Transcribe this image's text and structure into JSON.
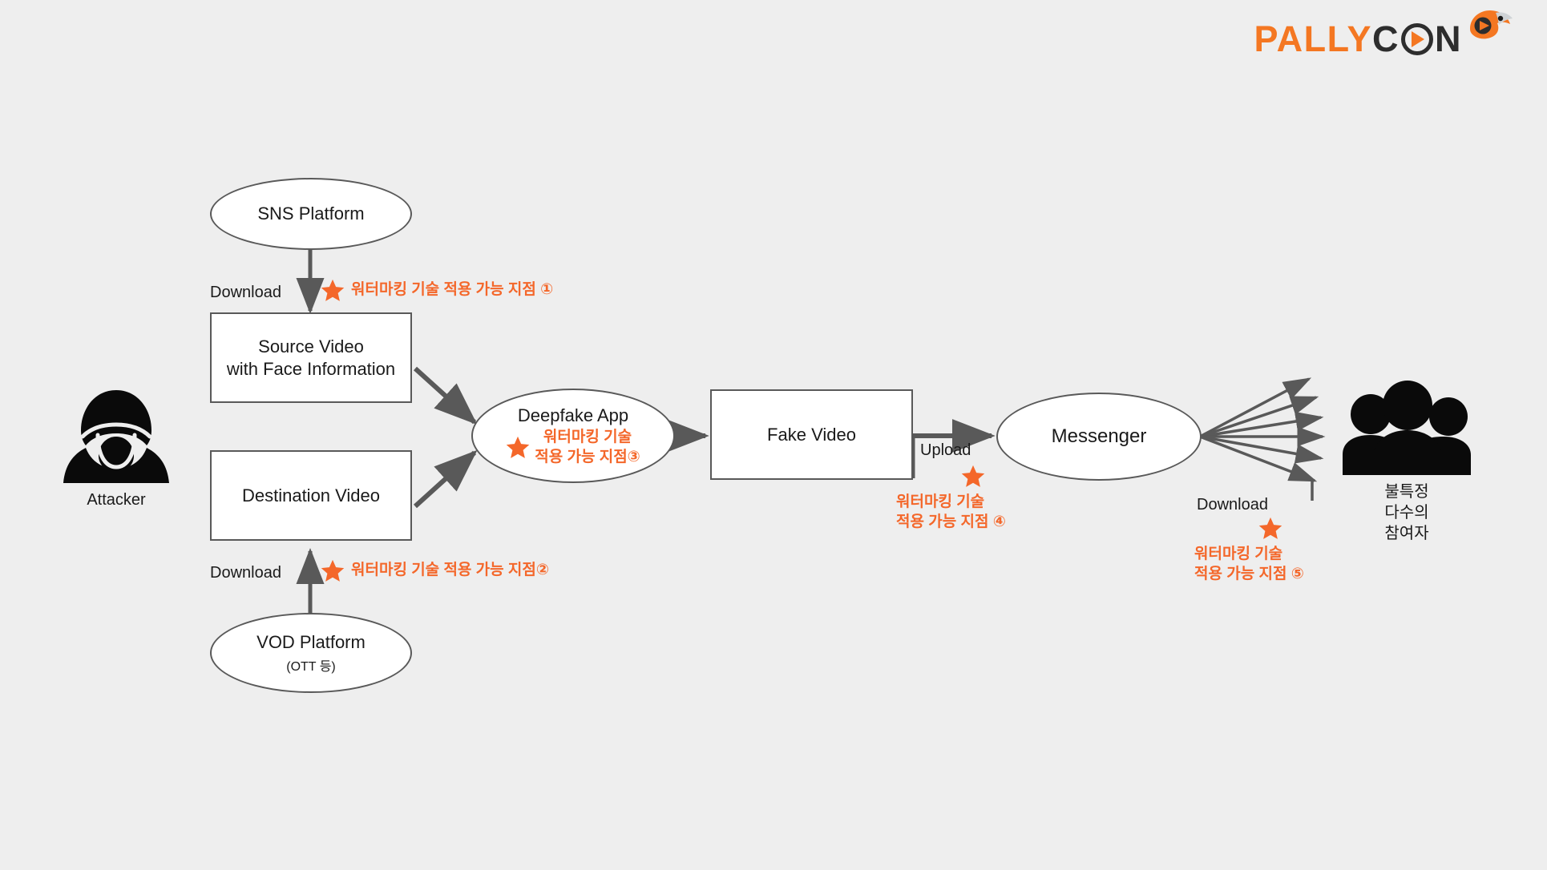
{
  "page": {
    "background_color": "#eeeeee",
    "accent_color": "#f4672a",
    "stroke_color": "#595959"
  },
  "logo": {
    "name": "pallycon-logo",
    "part1": "PALLY",
    "part2": "C",
    "part3": "N",
    "orange_hex": "#f47722",
    "dark_hex": "#2d2d2d"
  },
  "nodes": {
    "sns_platform": {
      "label": "SNS Platform"
    },
    "source_video": {
      "label": "Source Video\nwith Face Information"
    },
    "destination_video": {
      "label": "Destination Video"
    },
    "vod_platform": {
      "label": "VOD Platform",
      "sub": "(OTT 등)"
    },
    "deepfake_app": {
      "label": "Deepfake App"
    },
    "fake_video": {
      "label": "Fake Video"
    },
    "messenger": {
      "label": "Messenger"
    }
  },
  "actors": {
    "attacker": {
      "icon": "hooded-attacker-icon",
      "caption": "Attacker"
    },
    "participants": {
      "icon": "group-of-people-icon",
      "caption": "불특정\n다수의\n참여자"
    }
  },
  "edge_labels": {
    "download_1": "Download",
    "download_2": "Download",
    "upload": "Upload",
    "download_3": "Download"
  },
  "watermark_points": [
    {
      "id": "point-1",
      "text": "워터마킹 기술 적용 가능 지점 ①",
      "layout": "inline"
    },
    {
      "id": "point-2",
      "text": "워터마킹 기술 적용 가능 지점②",
      "layout": "inline"
    },
    {
      "id": "point-3",
      "text": "워터마킹 기술\n적용 가능 지점③",
      "layout": "inline-two-line"
    },
    {
      "id": "point-4",
      "text": "워터마킹 기술\n적용 가능 지점 ④",
      "layout": "stacked"
    },
    {
      "id": "point-5",
      "text": "워터마킹 기술\n적용 가능 지점 ⑤",
      "layout": "stacked"
    }
  ]
}
